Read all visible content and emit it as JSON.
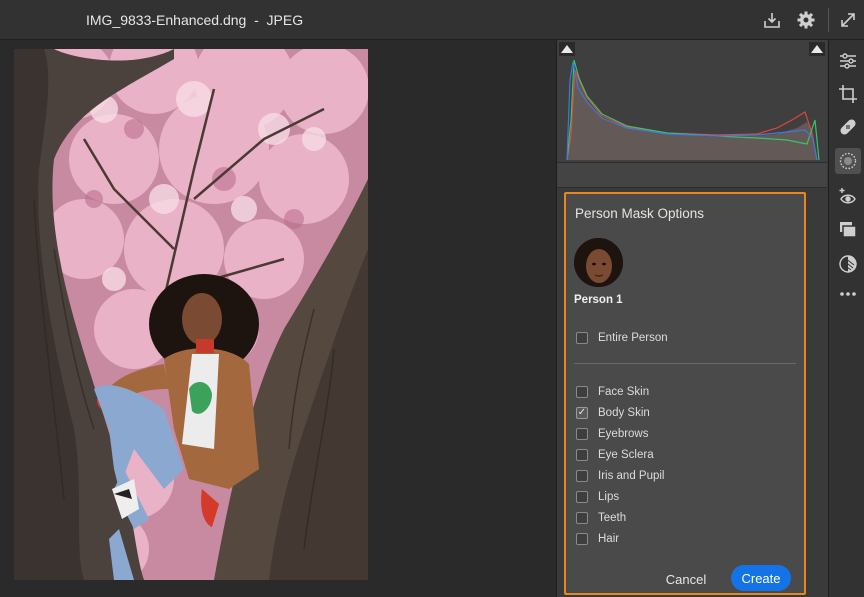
{
  "window": {
    "title": "IMG_9833-Enhanced.dng  -  JPEG"
  },
  "titlebar_icons": [
    "download-icon",
    "gear-icon",
    "expand-icon"
  ],
  "toolbar": {
    "tools": [
      "edit-sliders-icon",
      "crop-icon",
      "heal-icon",
      "masking-icon",
      "red-eye-icon",
      "presets-icon",
      "remove-icon",
      "more-icon"
    ],
    "active_tool": "masking-icon"
  },
  "mask_panel": {
    "title": "Person Mask Options",
    "person_label": "Person 1",
    "entire_person": {
      "label": "Entire Person",
      "checked": false
    },
    "options": [
      {
        "label": "Face Skin",
        "checked": false
      },
      {
        "label": "Body Skin",
        "checked": true
      },
      {
        "label": "Eyebrows",
        "checked": false
      },
      {
        "label": "Eye Sclera",
        "checked": false
      },
      {
        "label": "Iris and Pupil",
        "checked": false
      },
      {
        "label": "Lips",
        "checked": false
      },
      {
        "label": "Teeth",
        "checked": false
      },
      {
        "label": "Hair",
        "checked": false
      }
    ],
    "cancel_label": "Cancel",
    "create_label": "Create"
  },
  "colors": {
    "accent_border": "#e8871e",
    "primary_button": "#1473e6",
    "histogram_red": "#e0453a",
    "histogram_green": "#39c46a",
    "histogram_blue": "#3a7ae0"
  }
}
